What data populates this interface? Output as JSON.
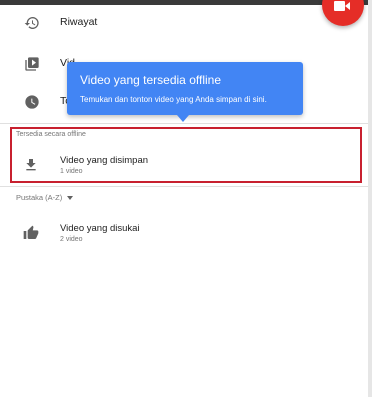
{
  "menu": {
    "history_label": "Riwayat",
    "videos_label": "Vid",
    "watch_later_label": "To"
  },
  "tooltip": {
    "title": "Video yang tersedia offline",
    "text": "Temukan dan tonton video yang Anda simpan di sini."
  },
  "offline_section": {
    "heading": "Tersedia secara offline",
    "saved_title": "Video yang disimpan",
    "saved_count": "1 video"
  },
  "library_section": {
    "heading": "Pustaka (A-Z)",
    "liked_title": "Video yang disukai",
    "liked_count": "2 video"
  },
  "colors": {
    "accent": "#4285f4",
    "fab": "#e52d27",
    "highlight": "#c8202f"
  },
  "icons": [
    "history-icon",
    "video-library-icon",
    "clock-icon",
    "download-icon",
    "thumb-up-icon",
    "video-camera-icon",
    "caret-down-icon"
  ]
}
